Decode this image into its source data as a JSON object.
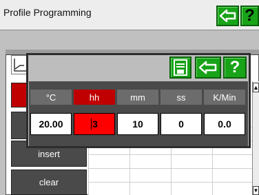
{
  "window": {
    "title": "Profile Programming"
  },
  "background": {
    "side_buttons": {
      "insert": "insert",
      "clear": "clear"
    }
  },
  "dialog": {
    "columns": [
      {
        "header": "°C",
        "value": "20.00",
        "active": false
      },
      {
        "header": "hh",
        "value": "3",
        "active": true
      },
      {
        "header": "mm",
        "value": "10",
        "active": false
      },
      {
        "header": "ss",
        "value": "0",
        "active": false
      },
      {
        "header": "K/Min",
        "value": "0.0",
        "active": false
      }
    ]
  },
  "icons": {
    "back": "arrow-left-icon",
    "help": "question-mark-icon",
    "save": "save-icon",
    "graph": "chart-icon"
  },
  "colors": {
    "accent_green": "#18a318",
    "active_red": "#c00000",
    "cell_red": "#ff0000"
  }
}
